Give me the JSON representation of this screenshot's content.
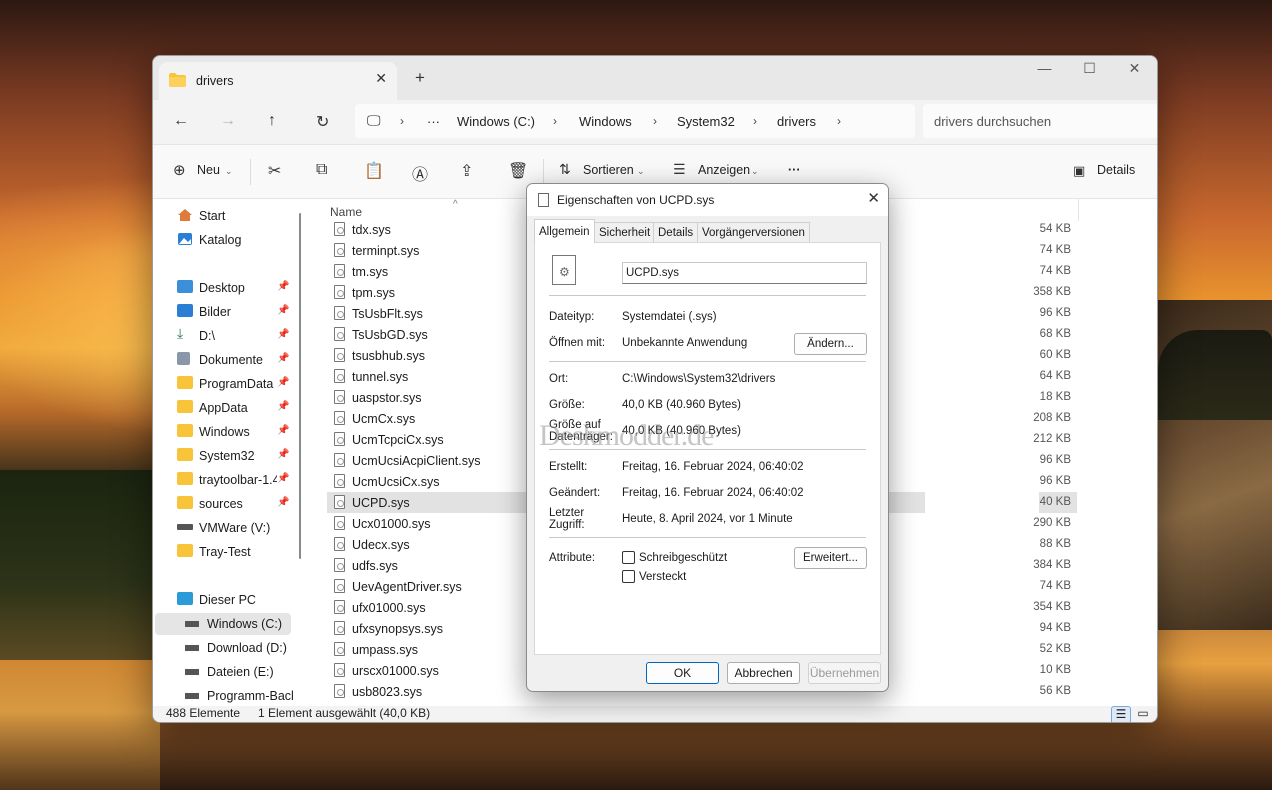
{
  "window": {
    "tab_title": "drivers",
    "new_tab": "+",
    "close_tab": "✕"
  },
  "address": {
    "more": "···",
    "crumbs": [
      "Windows (C:)",
      "Windows",
      "System32",
      "drivers"
    ],
    "search_placeholder": "drivers durchsuchen"
  },
  "toolbar": {
    "new_label": "Neu",
    "sort_label": "Sortieren",
    "view_label": "Anzeigen",
    "more": "···",
    "details_label": "Details"
  },
  "sidebar": {
    "items": [
      {
        "label": "Start",
        "icon": "home-icon"
      },
      {
        "label": "Katalog",
        "icon": "gallery-icon"
      },
      {
        "label": "Desktop",
        "icon": "desktop-icon",
        "pinned": true
      },
      {
        "label": "Bilder",
        "icon": "pictures-icon",
        "pinned": true
      },
      {
        "label": "D:\\",
        "icon": "download-icon",
        "pinned": true
      },
      {
        "label": "Dokumente",
        "icon": "documents-icon",
        "pinned": true
      },
      {
        "label": "ProgramData",
        "icon": "folder-icon",
        "pinned": true
      },
      {
        "label": "AppData",
        "icon": "folder-icon",
        "pinned": true
      },
      {
        "label": "Windows",
        "icon": "folder-icon",
        "pinned": true
      },
      {
        "label": "System32",
        "icon": "folder-icon",
        "pinned": true
      },
      {
        "label": "traytoolbar-1.4",
        "icon": "folder-icon",
        "pinned": true
      },
      {
        "label": "sources",
        "icon": "folder-icon",
        "pinned": true
      },
      {
        "label": "VMWare (V:)",
        "icon": "drive-icon"
      },
      {
        "label": "Tray-Test",
        "icon": "folder-icon"
      },
      {
        "label": "Dieser PC",
        "icon": "pc-icon"
      },
      {
        "label": "Windows (C:)",
        "icon": "windows-drive-icon",
        "selected": true
      },
      {
        "label": "Download (D:)",
        "icon": "drive-icon"
      },
      {
        "label": "Dateien (E:)",
        "icon": "drive-icon"
      },
      {
        "label": "Programm-Back",
        "icon": "drive-icon"
      }
    ]
  },
  "filelist": {
    "column_name": "Name",
    "files": [
      "tdx.sys",
      "terminpt.sys",
      "tm.sys",
      "tpm.sys",
      "TsUsbFlt.sys",
      "TsUsbGD.sys",
      "tsusbhub.sys",
      "tunnel.sys",
      "uaspstor.sys",
      "UcmCx.sys",
      "UcmTcpciCx.sys",
      "UcmUcsiAcpiClient.sys",
      "UcmUcsiCx.sys",
      "UCPD.sys",
      "Ucx01000.sys",
      "Udecx.sys",
      "udfs.sys",
      "UevAgentDriver.sys",
      "ufx01000.sys",
      "ufxsynopsys.sys",
      "umpass.sys",
      "urscx01000.sys",
      "usb8023.sys"
    ],
    "selected_index": 13,
    "sizes": [
      "54 KB",
      "74 KB",
      "74 KB",
      "358 KB",
      "96 KB",
      "68 KB",
      "60 KB",
      "64 KB",
      "18 KB",
      "208 KB",
      "212 KB",
      "96 KB",
      "96 KB",
      "40 KB",
      "290 KB",
      "88 KB",
      "384 KB",
      "74 KB",
      "354 KB",
      "94 KB",
      "52 KB",
      "10 KB",
      "56 KB"
    ]
  },
  "status": {
    "count": "488 Elemente",
    "selection": "1 Element ausgewählt (40,0 KB)"
  },
  "dialog": {
    "title": "Eigenschaften von UCPD.sys",
    "tabs": [
      "Allgemein",
      "Sicherheit",
      "Details",
      "Vorgängerversionen"
    ],
    "filename": "UCPD.sys",
    "type_label": "Dateityp:",
    "type_value": "Systemdatei (.sys)",
    "opens_label": "Öffnen mit:",
    "opens_value": "Unbekannte Anwendung",
    "change_button": "Ändern...",
    "location_label": "Ort:",
    "location_value": "C:\\Windows\\System32\\drivers",
    "size_label": "Größe:",
    "size_value": "40,0 KB (40.960 Bytes)",
    "disk_label_1": "Größe auf",
    "disk_label_2": "Datenträger:",
    "disk_value": "40,0 KB (40.960 Bytes)",
    "created_label": "Erstellt:",
    "created_value": "Freitag, 16. Februar 2024, 06:40:02",
    "modified_label": "Geändert:",
    "modified_value": "Freitag, 16. Februar 2024, 06:40:02",
    "accessed_label_1": "Letzter",
    "accessed_label_2": "Zugriff:",
    "accessed_value": "Heute, 8. April 2024, vor 1 Minute",
    "attributes_label": "Attribute:",
    "readonly_label": "Schreibgeschützt",
    "hidden_label": "Versteckt",
    "advanced_button": "Erweitert...",
    "ok_button": "OK",
    "cancel_button": "Abbrechen",
    "apply_button": "Übernehmen",
    "watermark": "Deskmodder.de"
  },
  "colors": {
    "accent": "#0067c0",
    "folder": "#f8c43a"
  }
}
